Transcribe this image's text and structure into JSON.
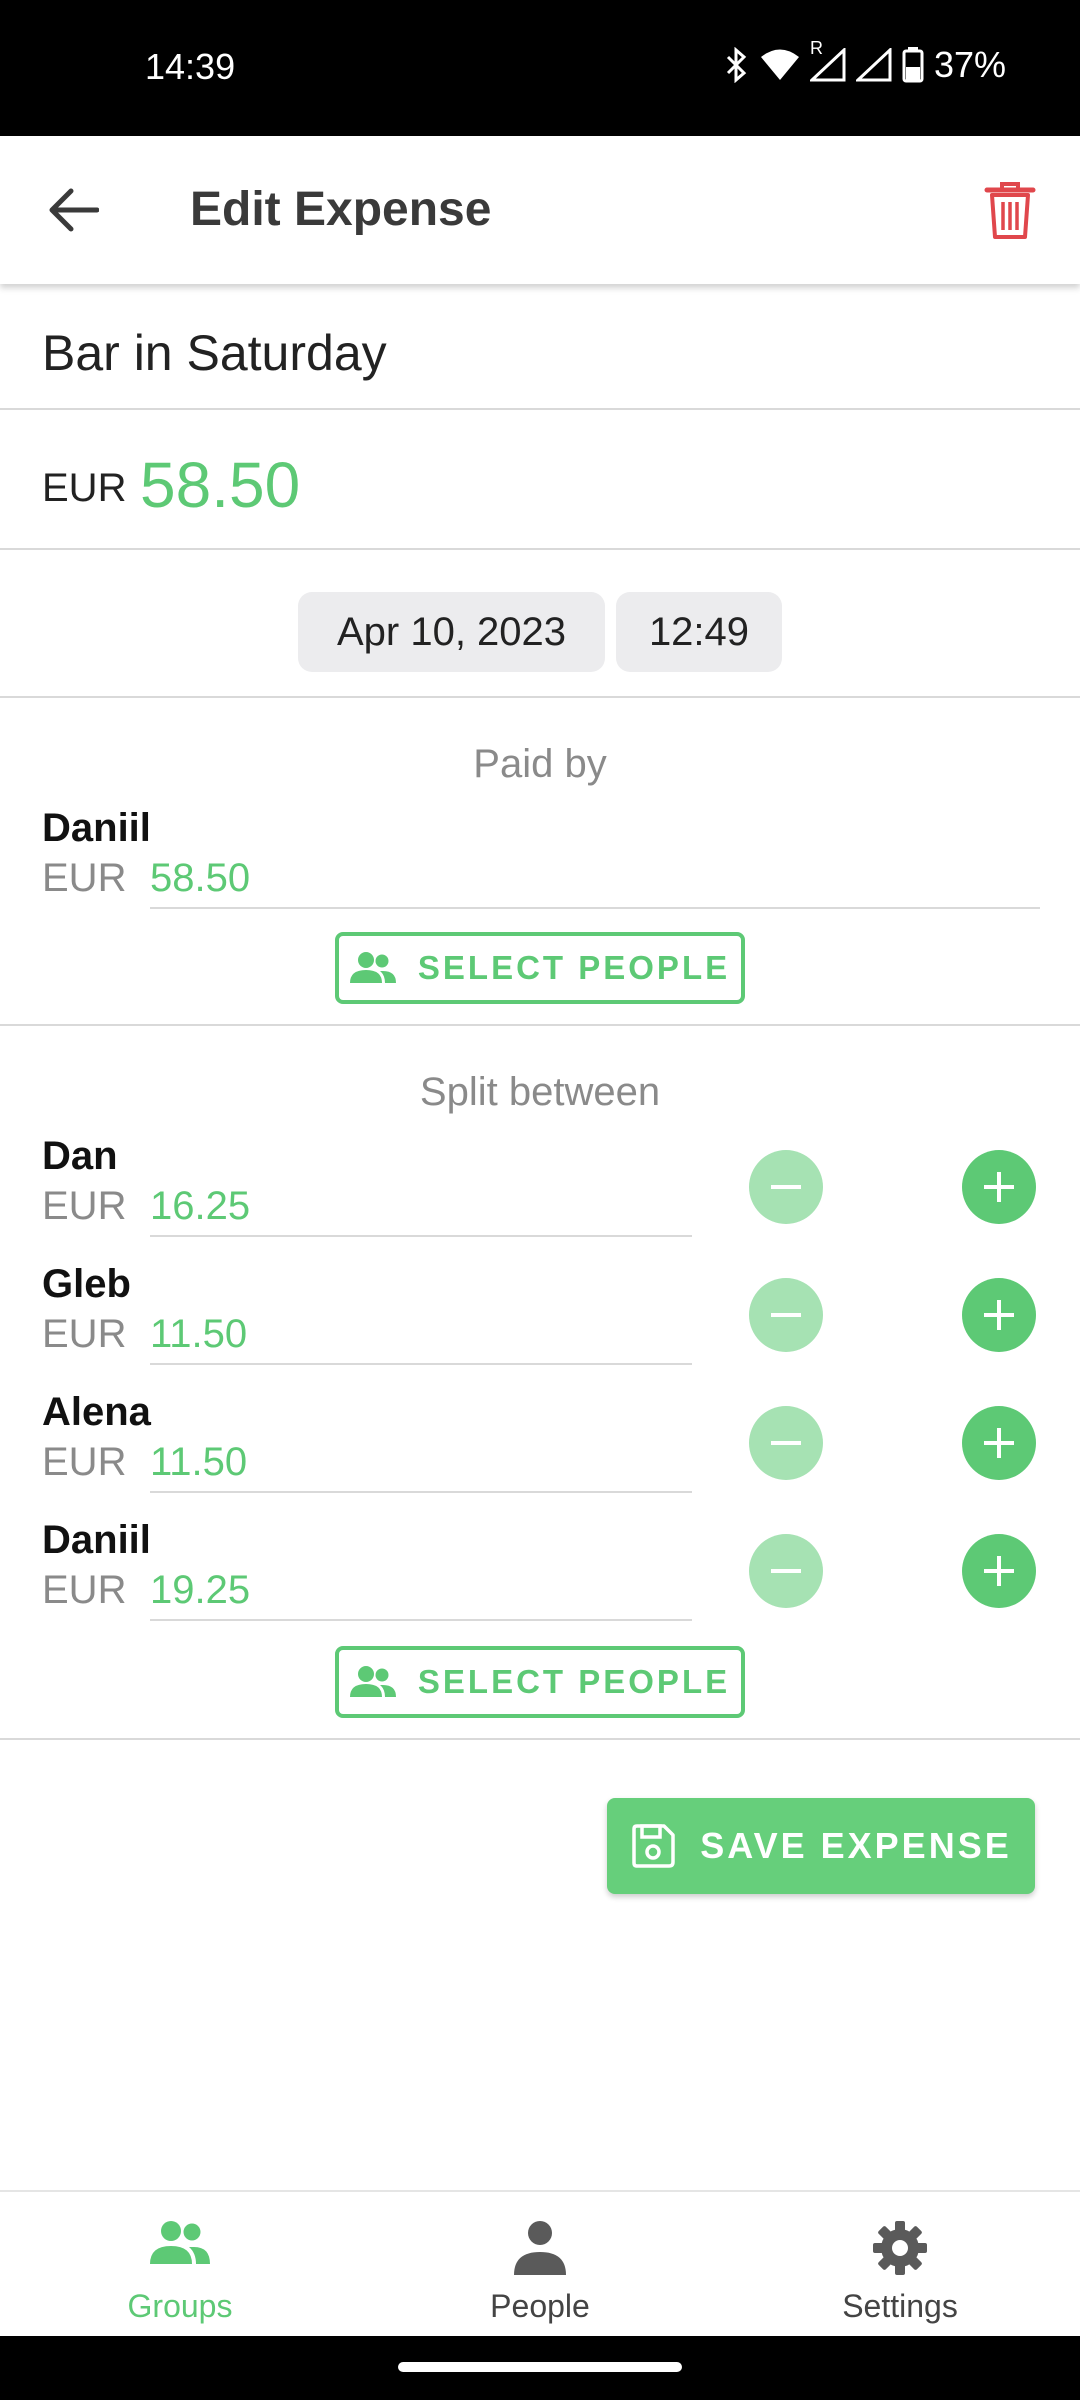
{
  "status_bar": {
    "time": "14:39",
    "roaming": "R",
    "battery": "37%"
  },
  "header": {
    "title": "Edit Expense",
    "back_icon": "arrow-left-icon",
    "delete_icon": "trash-icon"
  },
  "expense": {
    "title": "Bar in Saturday",
    "currency": "EUR",
    "amount": "58.50",
    "date": "Apr 10, 2023",
    "time": "12:49"
  },
  "paid_by": {
    "heading": "Paid by",
    "people": [
      {
        "name": "Daniil",
        "currency": "EUR",
        "amount": "58.50"
      }
    ],
    "select_label": "SELECT PEOPLE"
  },
  "split_between": {
    "heading": "Split between",
    "people": [
      {
        "name": "Dan",
        "currency": "EUR",
        "amount": "16.25"
      },
      {
        "name": "Gleb",
        "currency": "EUR",
        "amount": "11.50"
      },
      {
        "name": "Alena",
        "currency": "EUR",
        "amount": "11.50"
      },
      {
        "name": "Daniil",
        "currency": "EUR",
        "amount": "19.25"
      }
    ],
    "select_label": "SELECT PEOPLE"
  },
  "save_label": "SAVE EXPENSE",
  "bottom_nav": {
    "items": [
      {
        "label": "Groups",
        "icon": "groups-icon",
        "active": true
      },
      {
        "label": "People",
        "icon": "person-icon",
        "active": false
      },
      {
        "label": "Settings",
        "icon": "gear-icon",
        "active": false
      }
    ]
  },
  "colors": {
    "accent": "#5dc975",
    "accent_light": "#a6e2b3",
    "delete": "#e0474c"
  }
}
